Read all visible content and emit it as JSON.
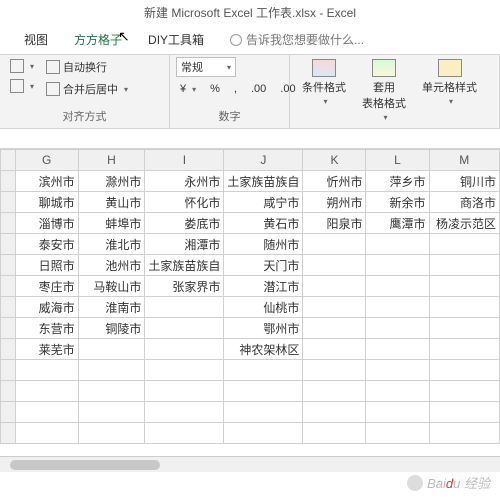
{
  "title": "新建 Microsoft Excel 工作表.xlsx - Excel",
  "tabs": {
    "view": "视图",
    "fanggezi": "方方格子",
    "diy": "DIY工具箱",
    "tellme": "告诉我您想要做什么..."
  },
  "ribbon": {
    "wrap": "自动换行",
    "merge": "合并后居中",
    "align_label": "对齐方式",
    "num_format": "常规",
    "currency": "%",
    "comma": ",",
    "inc_dec1": ".00",
    "inc_dec2": ".00",
    "num_label": "数字",
    "cond_fmt": "条件格式",
    "table_fmt": "套用\n表格格式",
    "cell_style": "单元格样式"
  },
  "cols": [
    "G",
    "H",
    "I",
    "J",
    "K",
    "L",
    "M"
  ],
  "rows": [
    [
      "滨州市",
      "滁州市",
      "永州市",
      "土家族苗族自",
      "忻州市",
      "萍乡市",
      "铜川市"
    ],
    [
      "聊城市",
      "黄山市",
      "怀化市",
      "咸宁市",
      "朔州市",
      "新余市",
      "商洛市"
    ],
    [
      "淄博市",
      "蚌埠市",
      "娄底市",
      "黄石市",
      "阳泉市",
      "鹰潭市",
      "杨凌示范区"
    ],
    [
      "泰安市",
      "淮北市",
      "湘潭市",
      "随州市",
      "",
      "",
      ""
    ],
    [
      "日照市",
      "池州市",
      "土家族苗族自",
      "天门市",
      "",
      "",
      ""
    ],
    [
      "枣庄市",
      "马鞍山市",
      "张家界市",
      "潜江市",
      "",
      "",
      ""
    ],
    [
      "威海市",
      "淮南市",
      "",
      "仙桃市",
      "",
      "",
      ""
    ],
    [
      "东营市",
      "铜陵市",
      "",
      "鄂州市",
      "",
      "",
      ""
    ],
    [
      "莱芜市",
      "",
      "",
      "神农架林区",
      "",
      "",
      ""
    ],
    [
      "",
      "",
      "",
      "",
      "",
      "",
      ""
    ],
    [
      "",
      "",
      "",
      "",
      "",
      "",
      ""
    ],
    [
      "",
      "",
      "",
      "",
      "",
      "",
      ""
    ],
    [
      "",
      "",
      "",
      "",
      "",
      "",
      ""
    ]
  ],
  "watermark": "经验"
}
